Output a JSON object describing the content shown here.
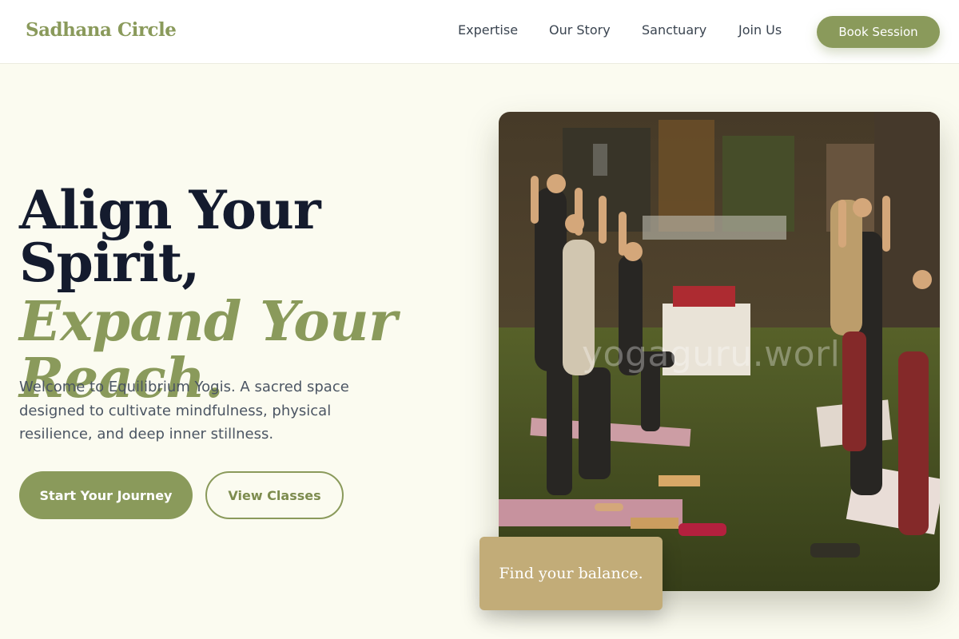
{
  "header": {
    "brand": "Sadhana Circle",
    "nav": [
      "Expertise",
      "Our Story",
      "Sanctuary",
      "Join Us"
    ],
    "cta": "Book Session"
  },
  "hero": {
    "headline_line1": "Align Your Spirit,",
    "headline_line2": "Expand Your Reach.",
    "intro": "Welcome to Equilibrium Yogis. A sacred space designed to cultivate mindfulness, physical resilience, and deep inner stillness.",
    "primary_button": "Start Your Journey",
    "secondary_button": "View Classes"
  },
  "photo": {
    "watermark": "yogaguru.worl",
    "caption": "Find your balance."
  },
  "colors": {
    "accent": "#8a9a5b",
    "background": "#fbfbf0",
    "heading": "#141b2e",
    "card": "#c2ac78"
  }
}
